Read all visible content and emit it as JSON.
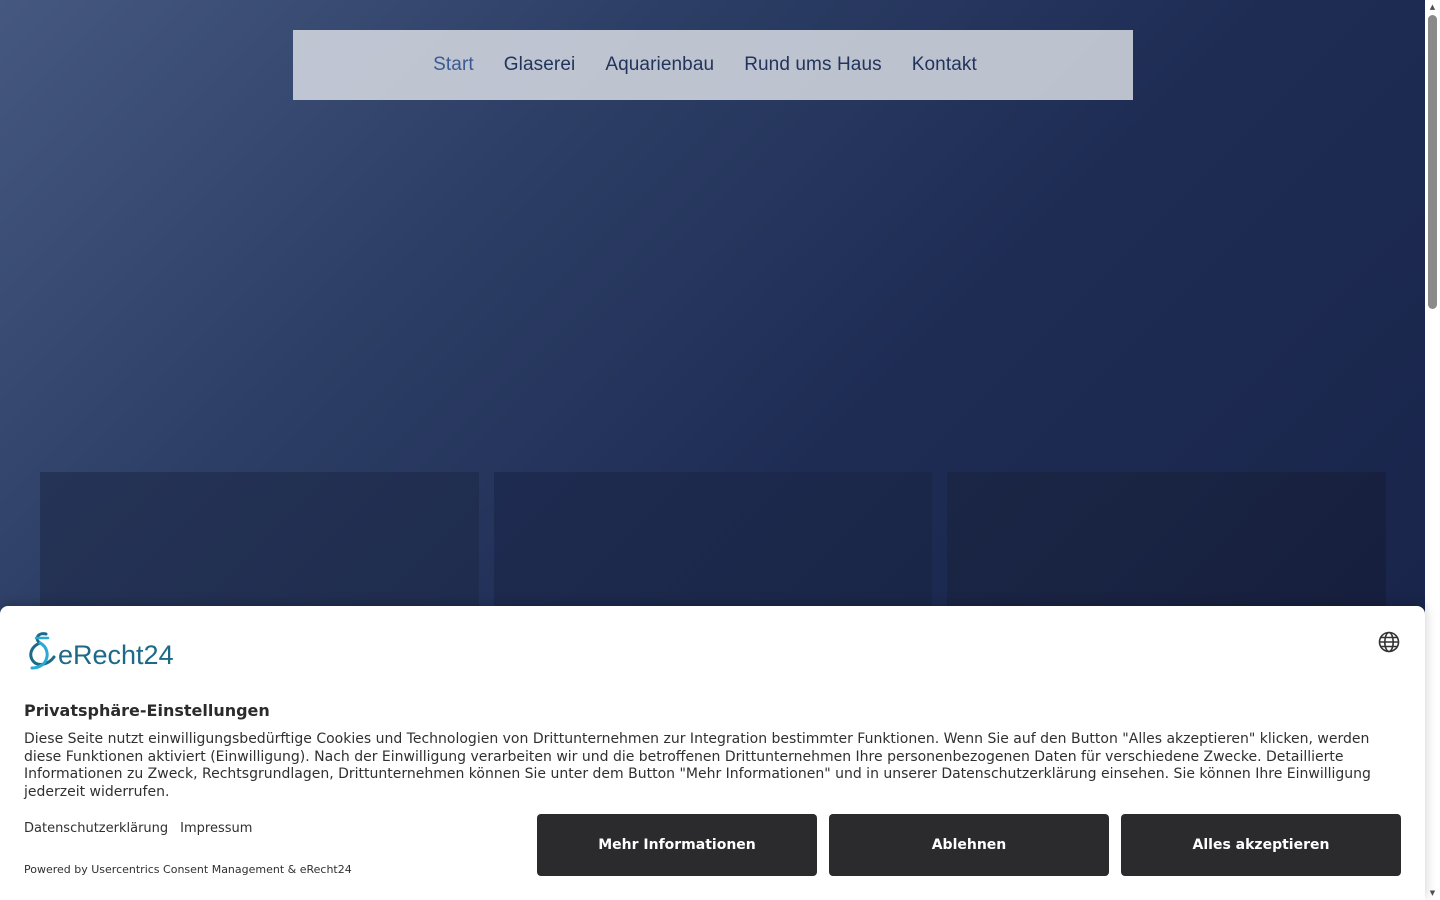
{
  "nav": {
    "items": [
      {
        "label": "Start",
        "active": true
      },
      {
        "label": "Glaserei",
        "active": false
      },
      {
        "label": "Aquarienbau",
        "active": false
      },
      {
        "label": "Rund ums Haus",
        "active": false
      },
      {
        "label": "Kontakt",
        "active": false
      }
    ]
  },
  "consent": {
    "logo_text": "eRecht24",
    "title": "Privatsphäre-Einstellungen",
    "description": "Diese Seite nutzt einwilligungsbedürftige Cookies und Technologien von Drittunternehmen zur Integration bestimmter Funktionen. Wenn Sie auf den Button \"Alles akzeptieren\" klicken, werden diese Funktionen aktiviert (Einwilligung). Nach der Einwilligung verarbeiten wir und die betroffenen Drittunternehmen Ihre personenbezogenen Daten für verschiedene Zwecke. Detaillierte Informationen zu Zweck, Rechtsgrundlagen, Drittunternehmen können Sie unter dem Button \"Mehr Informationen\" und in unserer Datenschutzerklärung einsehen. Sie können Ihre Einwilligung jederzeit widerrufen.",
    "links": {
      "privacy": "Datenschutzerklärung",
      "imprint": "Impressum"
    },
    "powered_by": "Powered by Usercentrics Consent Management & eRecht24",
    "buttons": {
      "more": "Mehr Informationen",
      "deny": "Ablehnen",
      "accept": "Alles akzeptieren"
    }
  },
  "colors": {
    "nav_text": "#22345c",
    "nav_active": "#3a5a94",
    "button_bg": "#2b2b2d",
    "logo": "#1c6a86"
  },
  "icons": {
    "language": "globe-icon",
    "logo": "ampersand-logo-icon"
  }
}
